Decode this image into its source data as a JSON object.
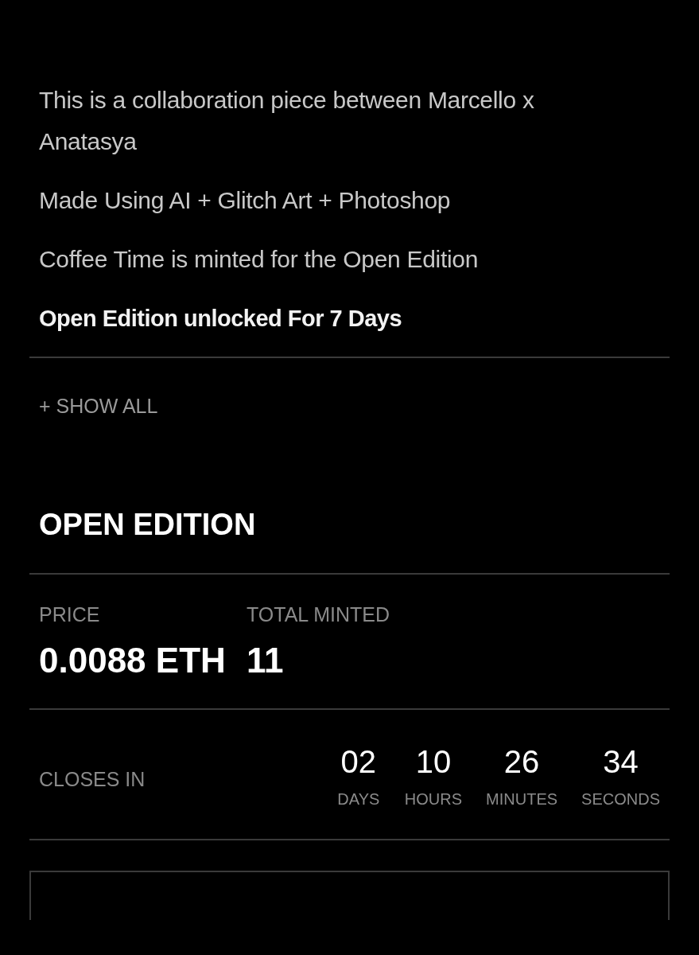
{
  "description": [
    {
      "text": "This is a collaboration piece between Marcello x Anatasya",
      "emphasis": false
    },
    {
      "text": "Made Using AI + Glitch Art + Photoshop",
      "emphasis": false
    },
    {
      "text": "Coffee Time is minted for the Open Edition",
      "emphasis": false
    },
    {
      "text": "Open Edition unlocked For 7 Days",
      "emphasis": true
    }
  ],
  "show_all": "+ SHOW ALL",
  "edition": {
    "title": "OPEN EDITION",
    "stats": [
      {
        "label": "PRICE",
        "value": "0.0088 ETH"
      },
      {
        "label": "TOTAL MINTED",
        "value": "11"
      }
    ],
    "closes_label": "CLOSES IN",
    "countdown": [
      {
        "value": "02",
        "unit": "DAYS"
      },
      {
        "value": "10",
        "unit": "HOURS"
      },
      {
        "value": "26",
        "unit": "MINUTES"
      },
      {
        "value": "34",
        "unit": "SECONDS"
      }
    ]
  }
}
